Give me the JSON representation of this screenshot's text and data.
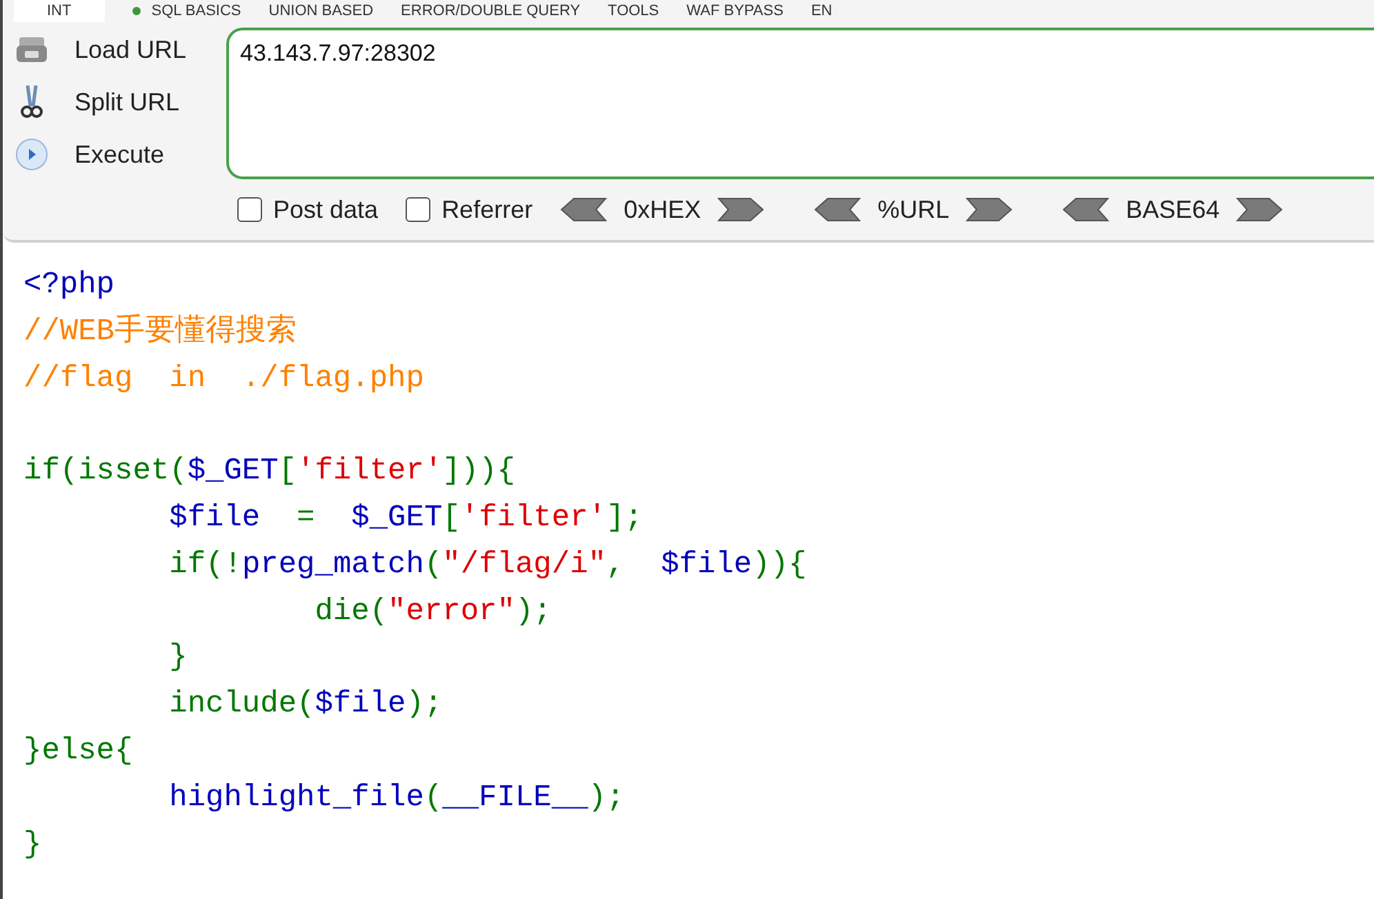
{
  "menu": [
    {
      "label": "INT",
      "selected": true
    },
    {
      "label": "SQL BASICS",
      "selected": false
    },
    {
      "label": "UNION BASED",
      "selected": false
    },
    {
      "label": "ERROR/DOUBLE QUERY",
      "selected": false
    },
    {
      "label": "TOOLS",
      "selected": false
    },
    {
      "label": "WAF BYPASS",
      "selected": false
    },
    {
      "label": "EN",
      "selected": false
    }
  ],
  "actions": [
    {
      "kind": "load",
      "label": "Load URL"
    },
    {
      "kind": "split",
      "label": "Split URL"
    },
    {
      "kind": "execute",
      "label": "Execute"
    }
  ],
  "url_field": {
    "value": "43.143.7.97:28302"
  },
  "options": [
    {
      "label": "Post data",
      "checked": false
    },
    {
      "label": "Referrer",
      "checked": false
    }
  ],
  "encoders": [
    {
      "label": "0xHEX"
    },
    {
      "label": "%URL"
    },
    {
      "label": "BASE64"
    }
  ],
  "code_lines": [
    {
      "kind": "code",
      "tokens": [
        {
          "kind": "default",
          "text": "<?php"
        }
      ]
    },
    {
      "kind": "code",
      "tokens": [
        {
          "kind": "comment",
          "text": "//WEB手要懂得搜索"
        }
      ]
    },
    {
      "kind": "code",
      "tokens": [
        {
          "kind": "comment",
          "text": "//flag  in  ./flag.php"
        }
      ]
    },
    {
      "kind": "blank"
    },
    {
      "kind": "code",
      "tokens": [
        {
          "kind": "keyword",
          "text": "if(isset("
        },
        {
          "kind": "default",
          "text": "$_GET"
        },
        {
          "kind": "keyword",
          "text": "["
        },
        {
          "kind": "string",
          "text": "'filter'"
        },
        {
          "kind": "keyword",
          "text": "])){"
        }
      ]
    },
    {
      "kind": "code",
      "tokens": [
        {
          "kind": "default",
          "text": "        $file"
        },
        {
          "kind": "keyword",
          "text": "  =  "
        },
        {
          "kind": "default",
          "text": "$_GET"
        },
        {
          "kind": "keyword",
          "text": "["
        },
        {
          "kind": "string",
          "text": "'filter'"
        },
        {
          "kind": "keyword",
          "text": "];"
        }
      ]
    },
    {
      "kind": "code",
      "tokens": [
        {
          "kind": "keyword",
          "text": "        if(!"
        },
        {
          "kind": "default",
          "text": "preg_match"
        },
        {
          "kind": "keyword",
          "text": "("
        },
        {
          "kind": "string",
          "text": "\"/flag/i\""
        },
        {
          "kind": "keyword",
          "text": ",  "
        },
        {
          "kind": "default",
          "text": "$file"
        },
        {
          "kind": "keyword",
          "text": ")){"
        }
      ]
    },
    {
      "kind": "code",
      "tokens": [
        {
          "kind": "keyword",
          "text": "                die("
        },
        {
          "kind": "string",
          "text": "\"error\""
        },
        {
          "kind": "keyword",
          "text": ");"
        }
      ]
    },
    {
      "kind": "code",
      "tokens": [
        {
          "kind": "keyword",
          "text": "        }"
        }
      ]
    },
    {
      "kind": "code",
      "tokens": [
        {
          "kind": "keyword",
          "text": "        include("
        },
        {
          "kind": "default",
          "text": "$file"
        },
        {
          "kind": "keyword",
          "text": ");"
        }
      ]
    },
    {
      "kind": "code",
      "tokens": [
        {
          "kind": "keyword",
          "text": "}else{"
        }
      ]
    },
    {
      "kind": "code",
      "tokens": [
        {
          "kind": "default",
          "text": "        highlight_file"
        },
        {
          "kind": "keyword",
          "text": "("
        },
        {
          "kind": "default",
          "text": "__FILE__"
        },
        {
          "kind": "keyword",
          "text": ");"
        }
      ]
    },
    {
      "kind": "code",
      "tokens": [
        {
          "kind": "keyword",
          "text": "}"
        }
      ]
    }
  ]
}
